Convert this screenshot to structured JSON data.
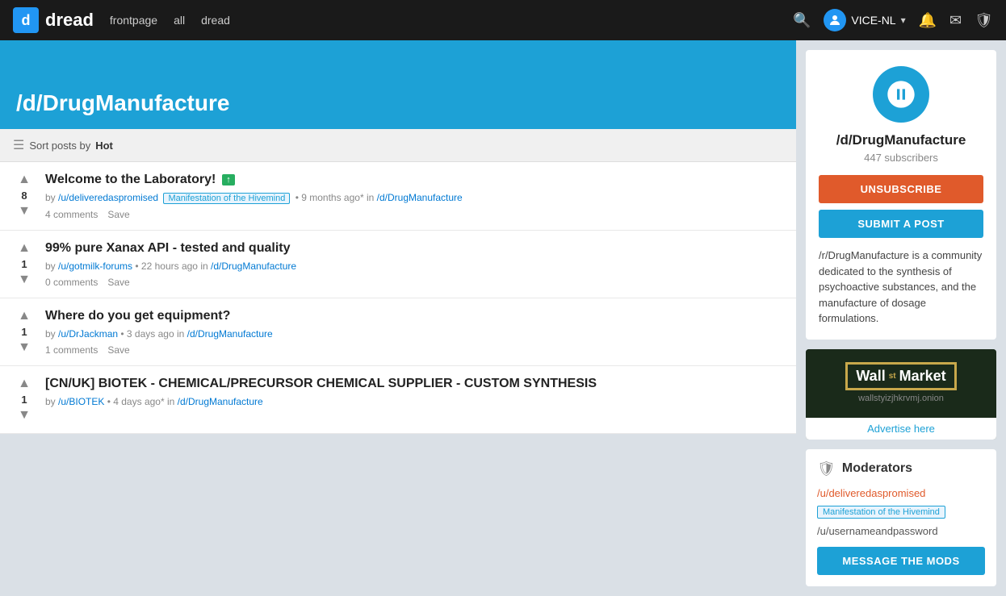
{
  "navbar": {
    "logo_letter": "d",
    "logo_text": "dread",
    "links": [
      "frontpage",
      "all",
      "dread"
    ],
    "username": "VICE-NL"
  },
  "subreddit": {
    "name": "/d/DrugManufacture",
    "subscribers": "447 subscribers",
    "description": "/r/DrugManufacture is a community dedicated to the synthesis of psychoactive substances, and the manufacture of dosage formulations.",
    "unsubscribe_label": "UNSUBSCRIBE",
    "submit_label": "SUBMIT A POST"
  },
  "sort_bar": {
    "text": "Sort posts by",
    "current": "Hot"
  },
  "posts": [
    {
      "id": 1,
      "votes": "8",
      "title": "Welcome to the Laboratory!",
      "has_badge": true,
      "badge_text": "↑",
      "author": "/u/deliveredaspromised",
      "flair": "Manifestation of the Hivemind",
      "time": "9 months ago*",
      "subreddit": "/d/DrugManufacture",
      "comments": "4 comments",
      "save": "Save"
    },
    {
      "id": 2,
      "votes": "1",
      "title": "99% pure Xanax API - tested and quality",
      "has_badge": false,
      "author": "/u/gotmilk-forums",
      "time": "22 hours ago",
      "subreddit": "/d/DrugManufacture",
      "comments": "0 comments",
      "save": "Save"
    },
    {
      "id": 3,
      "votes": "1",
      "title": "Where do you get equipment?",
      "has_badge": false,
      "author": "/u/DrJackman",
      "time": "3 days ago",
      "subreddit": "/d/DrugManufacture",
      "comments": "1 comments",
      "save": "Save"
    },
    {
      "id": 4,
      "votes": "1",
      "title": "[CN/UK] BIOTEK - CHEMICAL/PRECURSOR CHEMICAL SUPPLIER - CUSTOM SYNTHESIS",
      "has_badge": false,
      "author": "/u/BIOTEK",
      "time": "4 days ago*",
      "subreddit": "/d/DrugManufacture",
      "comments": "",
      "save": ""
    }
  ],
  "ad": {
    "title_small": "Wall",
    "title_sup": "st",
    "title_large": "Market",
    "url": "wallstyizjhkrvmj.onion",
    "advertise_text": "Advertise here"
  },
  "moderators": {
    "title": "Moderators",
    "mods": [
      {
        "name": "/u/deliveredaspromised",
        "flair": "Manifestation of the Hivemind"
      },
      {
        "name": "/u/usernameandpassword"
      }
    ],
    "message_label": "MESSAGE THE MODS"
  }
}
